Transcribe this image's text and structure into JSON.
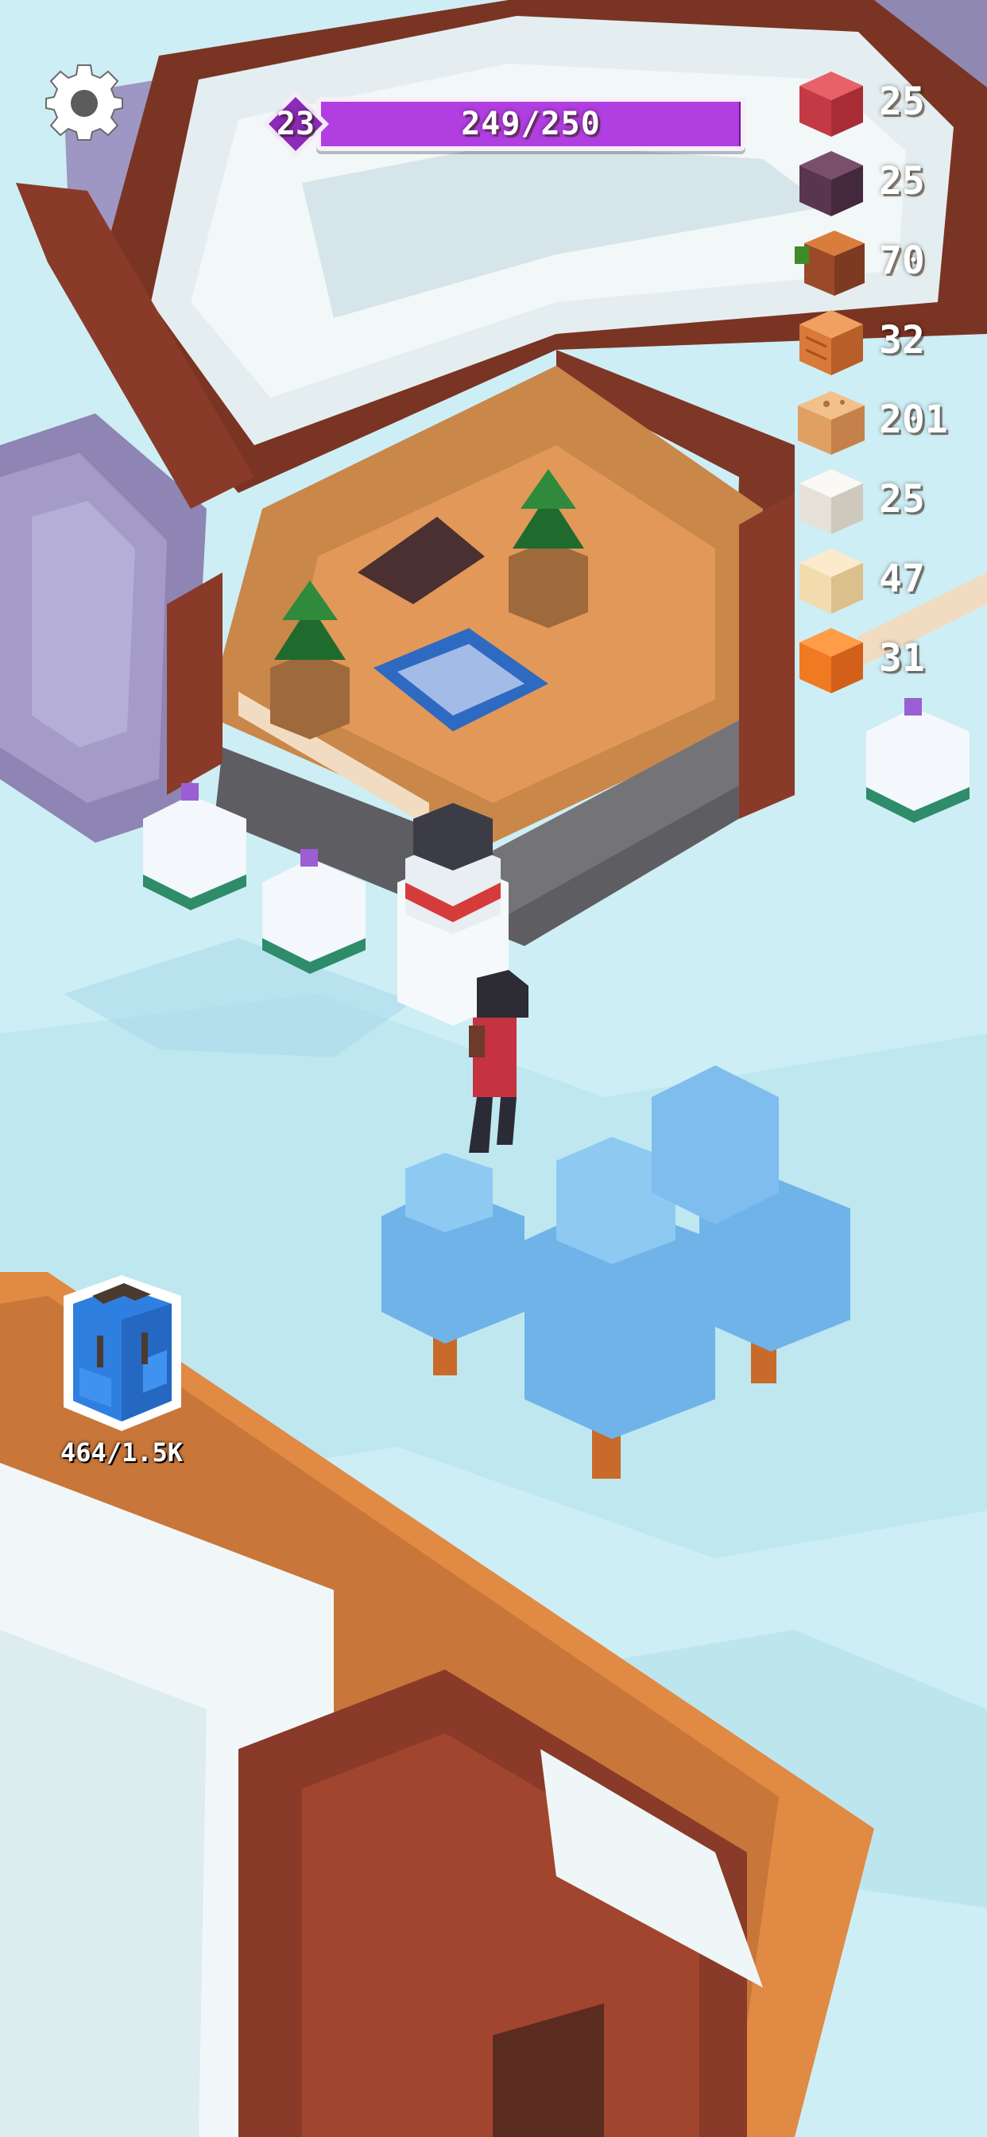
{
  "hud": {
    "level": "23",
    "xp_text": "249/250",
    "xp_progress": 0.996,
    "colors": {
      "xp_fill": "#b13ee0",
      "xp_track": "#6a1a8a",
      "badge": "#8c2bb8"
    }
  },
  "resources": [
    {
      "icon": "red-block-icon",
      "color": "#d8424a",
      "count": "25"
    },
    {
      "icon": "dark-purple-block-icon",
      "color": "#5a3550",
      "count": "25"
    },
    {
      "icon": "log-sapling-icon",
      "color": "#9a4a28",
      "count": "70"
    },
    {
      "icon": "wood-crate-icon",
      "color": "#d9793a",
      "count": "32"
    },
    {
      "icon": "plank-stack-icon",
      "color": "#e0a062",
      "count": "201"
    },
    {
      "icon": "white-block-icon",
      "color": "#efece6",
      "count": "25"
    },
    {
      "icon": "sand-block-icon",
      "color": "#f2dcae",
      "count": "47"
    },
    {
      "icon": "orange-block-icon",
      "color": "#f07a22",
      "count": "31"
    }
  ],
  "backpack": {
    "icon": "backpack-icon",
    "capacity_text": "464/1.5K",
    "color": "#2f7fe0"
  }
}
